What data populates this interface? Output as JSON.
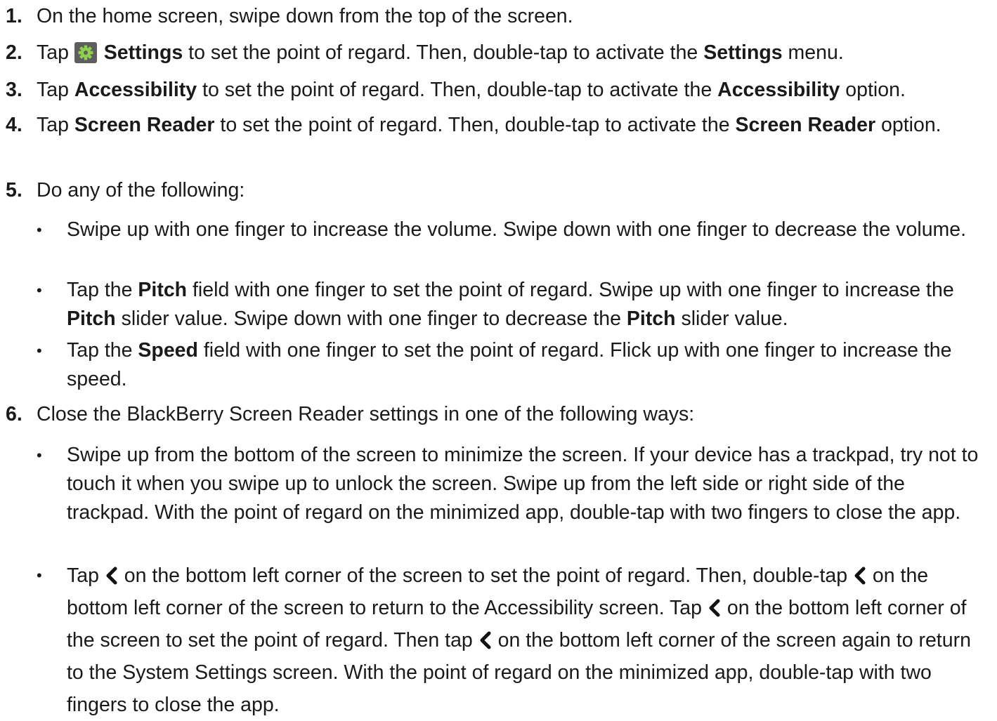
{
  "steps": [
    {
      "num": "1.",
      "text": "On the home screen, swipe down from the top of the screen."
    },
    {
      "num": "2.",
      "t1": "Tap ",
      "b1": "Settings",
      "t2": " to set the point of regard. Then, double-tap to activate the ",
      "b2": "Settings",
      "t3": " menu."
    },
    {
      "num": "3.",
      "t1": "Tap ",
      "b1": "Accessibility",
      "t2": " to set the point of regard. Then, double-tap to activate the ",
      "b2": "Accessibility",
      "t3": " option."
    },
    {
      "num": "4.",
      "t1": "Tap ",
      "b1": "Screen Reader",
      "t2": " to set the point of regard. Then, double-tap to activate the ",
      "b2": "Screen Reader",
      "t3": " option."
    },
    {
      "num": "5.",
      "text": "Do any of the following:"
    },
    {
      "num": "6.",
      "text": "Close the BlackBerry Screen Reader settings in one of the following ways:"
    }
  ],
  "step5_bullets": [
    {
      "text": "Swipe up with one finger to increase the volume. Swipe down with one finger to decrease the volume."
    },
    {
      "t1": "Tap the ",
      "b1": "Pitch",
      "t2": " field with one finger to set the point of regard. Swipe up with one finger to increase the ",
      "b2": "Pitch",
      "t3": " slider value. Swipe down with one finger to decrease the ",
      "b3": "Pitch",
      "t4": " slider value."
    },
    {
      "t1": "Tap the ",
      "b1": "Speed",
      "t2": " field with one finger to set the point of regard. Flick up with one finger to increase the speed."
    }
  ],
  "step6_bullets": [
    {
      "text": "Swipe up from the bottom of the screen to minimize the screen. If your device has a trackpad, try not to touch it when you swipe up to unlock the screen. Swipe up from the left side or right side of the trackpad. With the point of regard on the minimized app, double-tap with two fingers to close the app."
    },
    {
      "t1": "Tap ",
      "t2": " on the bottom left corner of the screen to set the point of regard. Then, double-tap ",
      "t3": " on the bottom left corner of the screen to return to the Accessibility screen. Tap ",
      "t4": " on the bottom left corner of the screen to set the point of regard. Then tap ",
      "t5": " on the bottom left corner of the screen again to return to the System Settings screen. With the point of regard on the minimized app, double-tap with two fingers to close the app."
    }
  ],
  "bullet_glyph": "•",
  "icons": {
    "settings": "gear-icon",
    "back": "chevron-left-icon"
  }
}
